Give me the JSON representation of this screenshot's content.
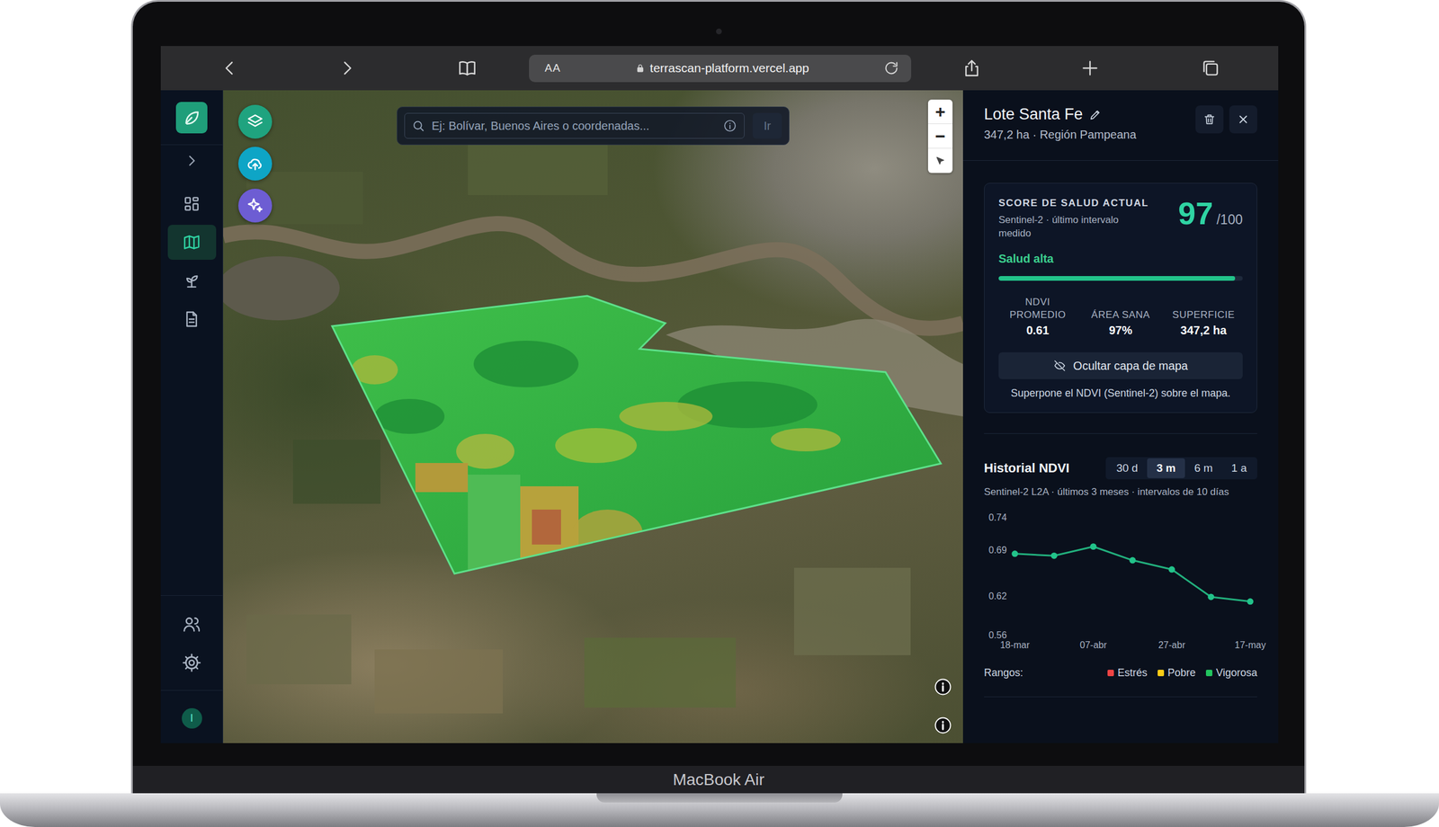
{
  "browser": {
    "reader": "AA",
    "url": "terrascan-platform.vercel.app"
  },
  "sidebar": {
    "items": [
      {
        "kind": "dashboard",
        "selected": false
      },
      {
        "kind": "map",
        "selected": true
      },
      {
        "kind": "crops",
        "selected": false
      },
      {
        "kind": "reports",
        "selected": false
      }
    ],
    "bottom_items": [
      {
        "kind": "users"
      },
      {
        "kind": "settings"
      }
    ],
    "avatar": "I"
  },
  "map": {
    "search": {
      "placeholder": "Ej: Bolívar, Buenos Aires o coordenadas...",
      "button": "Ir"
    },
    "zoom": {
      "in": "+",
      "out": "−"
    },
    "overlay": {
      "visible": true
    }
  },
  "lot": {
    "title": "Lote Santa Fe",
    "subtitle": "347,2 ha · Región Pampeana"
  },
  "health": {
    "label": "SCORE DE SALUD ACTUAL",
    "source": "Sentinel-2 · último intervalo medido",
    "score": "97",
    "max": "/100",
    "status": "Salud alta",
    "level": 0.97,
    "stats": [
      {
        "label": "NDVI PROMEDIO",
        "value": "0.61"
      },
      {
        "label": "ÁREA SANA",
        "value": "97%"
      },
      {
        "label": "SUPERFICIE",
        "value": "347,2 ha"
      }
    ],
    "toggle_button": "Ocultar capa de mapa",
    "caption": "Superpone el NDVI (Sentinel-2) sobre el mapa."
  },
  "history": {
    "title": "Historial NDVI",
    "ranges": [
      {
        "label": "30 d",
        "selected": false
      },
      {
        "label": "3 m",
        "selected": true
      },
      {
        "label": "6 m",
        "selected": false
      },
      {
        "label": "1 a",
        "selected": false
      }
    ],
    "subtitle": "Sentinel-2 L2A · últimos 3 meses · intervalos de 10 días",
    "chart": {
      "y_ticks": [
        "0.74",
        "0.69",
        "0.62",
        "0.56"
      ],
      "x_ticks": [
        "18-mar",
        "07-abr",
        "27-abr",
        "17-may"
      ],
      "series": [
        {
          "values": [
            0.684,
            0.681,
            0.695,
            0.674,
            0.66,
            0.618,
            0.611
          ]
        }
      ]
    },
    "legend": {
      "label": "Rangos:",
      "items": [
        {
          "label": "Estrés",
          "color": "#ef4444"
        },
        {
          "label": "Pobre",
          "color": "#facc15"
        },
        {
          "label": "Vigorosa",
          "color": "#22c55e"
        }
      ]
    }
  },
  "device": {
    "label": "MacBook Air"
  }
}
